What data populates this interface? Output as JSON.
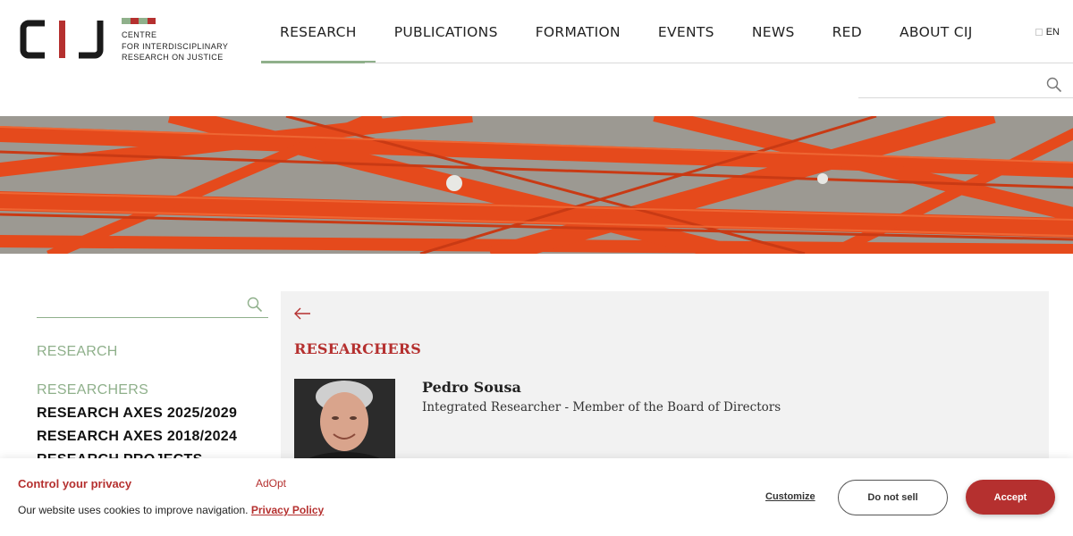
{
  "logo": {
    "mark": "CIJ",
    "lines": [
      "CENTRE",
      "FOR INTERDISCIPLINARY",
      "RESEARCH ON JUSTICE"
    ],
    "stripe_colors": [
      "#8fb08b",
      "#b5302f",
      "#8fb08b",
      "#b5302f"
    ]
  },
  "nav": {
    "items": [
      "RESEARCH",
      "PUBLICATIONS",
      "FORMATION",
      "EVENTS",
      "NEWS",
      "RED",
      "ABOUT CIJ"
    ],
    "active": "RESEARCH"
  },
  "lang": {
    "label": "EN"
  },
  "search": {
    "placeholder": ""
  },
  "sidebar": {
    "title": "RESEARCH",
    "items": [
      "RESEARCHERS",
      "RESEARCH AXES 2025/2029",
      "RESEARCH AXES 2018/2024",
      "RESEARCH PROJECTS"
    ],
    "current": "RESEARCHERS"
  },
  "content": {
    "section_title": "RESEARCHERS",
    "person": {
      "name": "Pedro Sousa",
      "role": "Integrated Researcher - Member of the Board of Directors"
    }
  },
  "cookie": {
    "title": "Control your privacy",
    "brand": "AdOpt",
    "text": "Our website uses cookies to improve navigation.",
    "policy_link": "Privacy Policy",
    "customize": "Customize",
    "do_not_sell": "Do not sell",
    "accept": "Accept"
  },
  "colors": {
    "accent_red": "#b5302f",
    "accent_green": "#8fb08b",
    "content_bg": "#f2f2f2"
  }
}
